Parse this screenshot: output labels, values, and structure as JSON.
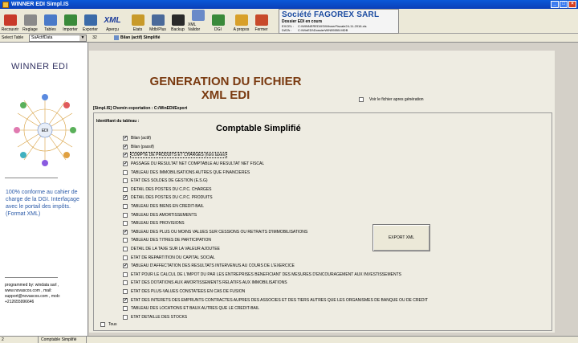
{
  "window": {
    "title": "WINNER EDI Simpl.IS"
  },
  "toolbar": {
    "buttons": [
      {
        "label": "Recouvrir",
        "icon": "recouvrir-icon",
        "color": "#c83a2a"
      },
      {
        "label": "Reglage",
        "icon": "tools-icon",
        "color": "#8a8a8a"
      },
      {
        "label": "Tables",
        "icon": "tables-icon",
        "color": "#4a7ac8"
      },
      {
        "label": "Importer",
        "icon": "import-icon",
        "color": "#3a8a3a"
      },
      {
        "label": "Exporter",
        "icon": "export-icon",
        "color": "#3a6aa8"
      },
      {
        "label": "Aperçu",
        "icon": "xml-icon",
        "color": "#1a3a9a",
        "glyph": "XML"
      },
      {
        "label": "Etats",
        "icon": "reports-icon",
        "color": "#c89a2a"
      },
      {
        "label": "Mdb/Plus",
        "icon": "database-icon",
        "color": "#4a6a9a"
      },
      {
        "label": "Backup",
        "icon": "backup-icon",
        "color": "#2a2a2a"
      },
      {
        "label": "XML Validor",
        "icon": "validator-icon",
        "color": "#6a8ac8"
      },
      {
        "label": "DGI",
        "icon": "dgi-icon",
        "color": "#3a8a3a"
      },
      {
        "label": "A propos",
        "icon": "lock-icon",
        "color": "#d8a02a"
      },
      {
        "label": "Fermer",
        "icon": "exit-door-icon",
        "color": "#c84a2a"
      }
    ]
  },
  "company": {
    "name": "Société FAGOREX SARL",
    "subtitle": "Dossier EDI en cours",
    "excel_label": "EXCEL :",
    "excel_path": "C:\\WINNEREDI\\IS\\WinnerFiscale24-11-2016.xls",
    "data_label": "DATA :",
    "data_path": "C:\\WinEDI\\DossierWIN55555.MDB"
  },
  "selectbar": {
    "label": "Select Table",
    "value": "SaActifData",
    "number": "32",
    "caption": "Bilan (actif) Simplifié"
  },
  "left_panel": {
    "brand": "WINNER EDI",
    "diagram_center": "EDI",
    "blurb": "100% conforme au cahier de charge de la DGI. Interfaçage avec le portail des impôts. (Format XML)",
    "contact": "programmed by: windata sarl , www.novascos.com , mail: support@novascos.com , mob: +212655996646"
  },
  "main": {
    "title_line1": "GENERATION DU FICHIER",
    "title_line2": "XML EDI",
    "voir_label": "Voir le fichier apres génération",
    "path_label": "[Simpl.IS] Chemin exportation : C:/WinEDI/Export",
    "ident_label": "Identifiant du tableau :",
    "comptable_title": "Comptable Simplifié",
    "export_button": "EXPORT XML",
    "tous_label": "Tous",
    "items": [
      {
        "label": "Bilan (actif)",
        "checked": true
      },
      {
        "label": "Bilan (passif)",
        "checked": true
      },
      {
        "label": "COMPTE DE PRODUITS ET CHARGES (hors taxes)",
        "checked": true,
        "focus": true
      },
      {
        "label": "PASSAGE DU RESULTAT NET COMPTABLE AU RESULTAT NET FISCAL",
        "checked": true
      },
      {
        "label": "TABLEAU DES IMMOBILISATIONS AUTRES QUE FINANCIERES",
        "checked": false
      },
      {
        "label": "ETAT DES SOLDES DE GESTION (E.S.G)",
        "checked": false
      },
      {
        "label": "DETAIL DES POSTES DU C.P.C. CHARGES",
        "checked": false
      },
      {
        "label": "DETAIL DES POSTES DU C.P.C. PRODUITS",
        "checked": true
      },
      {
        "label": "TABLEAU DES BIENS EN CREDIT-BAIL",
        "checked": false
      },
      {
        "label": "TABLEAU DES AMORTISSEMENTS",
        "checked": false
      },
      {
        "label": "TABLEAU DES PROVISIONS",
        "checked": false
      },
      {
        "label": "TABLEAU DES PLUS OU MOINS VALUES SUR CESSIONS OU RETRAITS D'IMMOBILISATIONS",
        "checked": true
      },
      {
        "label": "TABLEAU DES TITRES DE PARTICIPATION",
        "checked": false
      },
      {
        "label": "DETAIL DE LA TAXE SUR LA VALEUR AJOUTEE",
        "checked": false
      },
      {
        "label": "ETAT DE REPARTITION DU CAPITAL SOCIAL",
        "checked": false
      },
      {
        "label": "TABLEAU D'AFFECTATION DES RESULTATS INTERVENUS AU COURS DE L'EXERCICE",
        "checked": true
      },
      {
        "label": "ETAT POUR LE CALCUL DE L'IMPOT DU PAR LES ENTREPRISES BENEFICIANT DES MESURES D'ENCOURAGEMENT AUX INVESTISSEMENTS",
        "checked": false
      },
      {
        "label": "ETAT DES DOTATIONS AUX AMORTISSEMENTS RELATIFS AUX IMMOBILISATIONS",
        "checked": false
      },
      {
        "label": "ETAT DES PLUS-VALUES CONSTATEES EN CAS DE FUSION",
        "checked": false
      },
      {
        "label": "ETAT DES INTERETS DES EMPRUNTS CONTRACTES AUPRES DES ASSOCIES ET DES TIERS AUTRES QUE LES ORGANISMES DE BANQUE OU DE CREDIT",
        "checked": true
      },
      {
        "label": "TABLEAU DES LOCATIONS ET BAUX AUTRES QUE LE CREDIT-BAIL",
        "checked": false
      },
      {
        "label": "ETAT DETAILLE DES STOCKS",
        "checked": false
      }
    ]
  },
  "statusbar": {
    "left": "2",
    "right": "Comptable Simplifié"
  }
}
